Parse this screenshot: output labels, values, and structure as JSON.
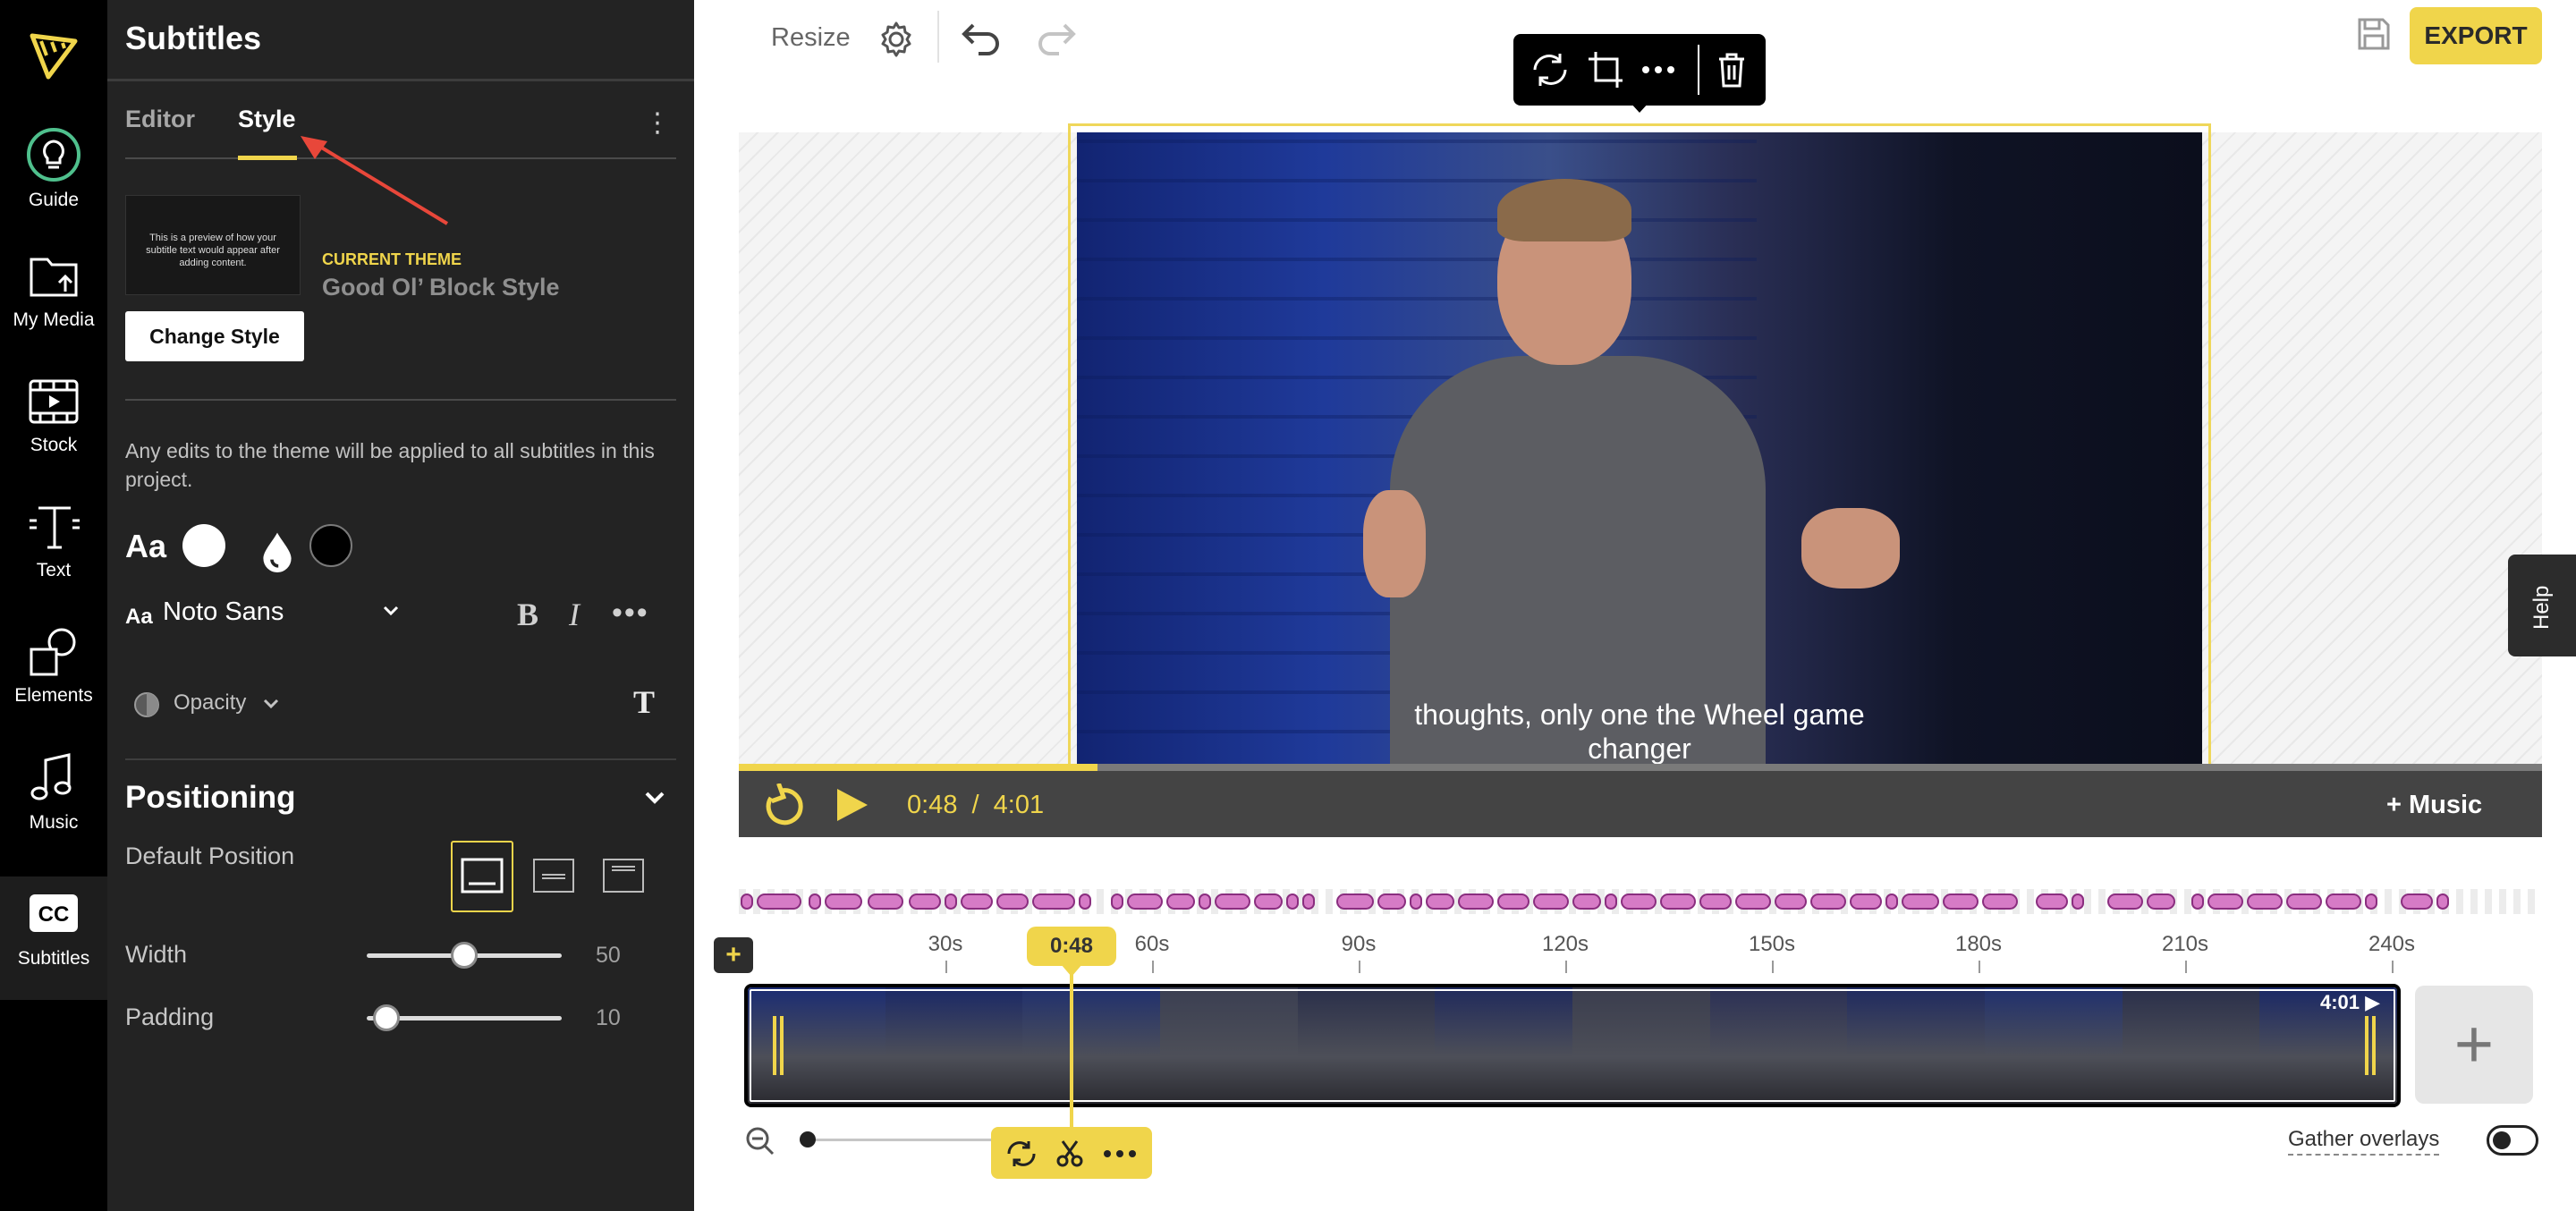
{
  "rail": {
    "items": [
      {
        "label": "Guide",
        "icon": "lightbulb-icon"
      },
      {
        "label": "My Media",
        "icon": "folder-upload-icon"
      },
      {
        "label": "Stock",
        "icon": "film-icon"
      },
      {
        "label": "Text",
        "icon": "text-icon"
      },
      {
        "label": "Elements",
        "icon": "shapes-icon"
      },
      {
        "label": "Music",
        "icon": "music-note-icon"
      },
      {
        "label": "Subtitles",
        "icon": "cc-icon"
      }
    ],
    "active": "Subtitles"
  },
  "panel": {
    "title": "Subtitles",
    "tabs": [
      {
        "label": "Editor"
      },
      {
        "label": "Style"
      }
    ],
    "active_tab": "Style",
    "preview_text": "This is a preview of how your subtitle text would appear after adding content.",
    "theme_caption": "CURRENT THEME",
    "theme_name": "Good Ol’ Block Style",
    "change_style_label": "Change Style",
    "note": "Any edits to the theme will be applied to all subtitles in this project.",
    "aa_label": "Aa",
    "colors": {
      "text": "#ffffff",
      "background": "#000000"
    },
    "font": {
      "aa": "Aa",
      "name": "Noto Sans"
    },
    "bold_label": "B",
    "italic_label": "I",
    "more_label": "•••",
    "opacity_label": "Opacity",
    "text_tool_label": "T",
    "positioning": {
      "title": "Positioning",
      "default_position_label": "Default Position",
      "selected": "bottom"
    },
    "width": {
      "label": "Width",
      "value": "50",
      "fraction": 0.5
    },
    "padding": {
      "label": "Padding",
      "value": "10",
      "fraction": 0.1
    }
  },
  "toolbar": {
    "resize_label": "Resize",
    "export_label": "EXPORT"
  },
  "video": {
    "subtitle_line1": "thoughts, only one the Wheel game",
    "subtitle_line2": "changer"
  },
  "help_label": "Help",
  "player": {
    "current_time": "0:48",
    "separator": "/",
    "total_time": "4:01",
    "progress_fraction": 0.199,
    "music_label": "+ Music"
  },
  "timeline": {
    "add_label": "+",
    "ticks": [
      "30s",
      "60s",
      "90s",
      "120s",
      "150s",
      "180s",
      "210s",
      "240s"
    ],
    "playhead_label": "0:48",
    "clip_duration": "4:01",
    "add_clip_label": "+",
    "gather_overlays_label": "Gather overlays"
  },
  "accent_color": "#f0d54b",
  "subtitle_segment_color": "#d67bc6"
}
